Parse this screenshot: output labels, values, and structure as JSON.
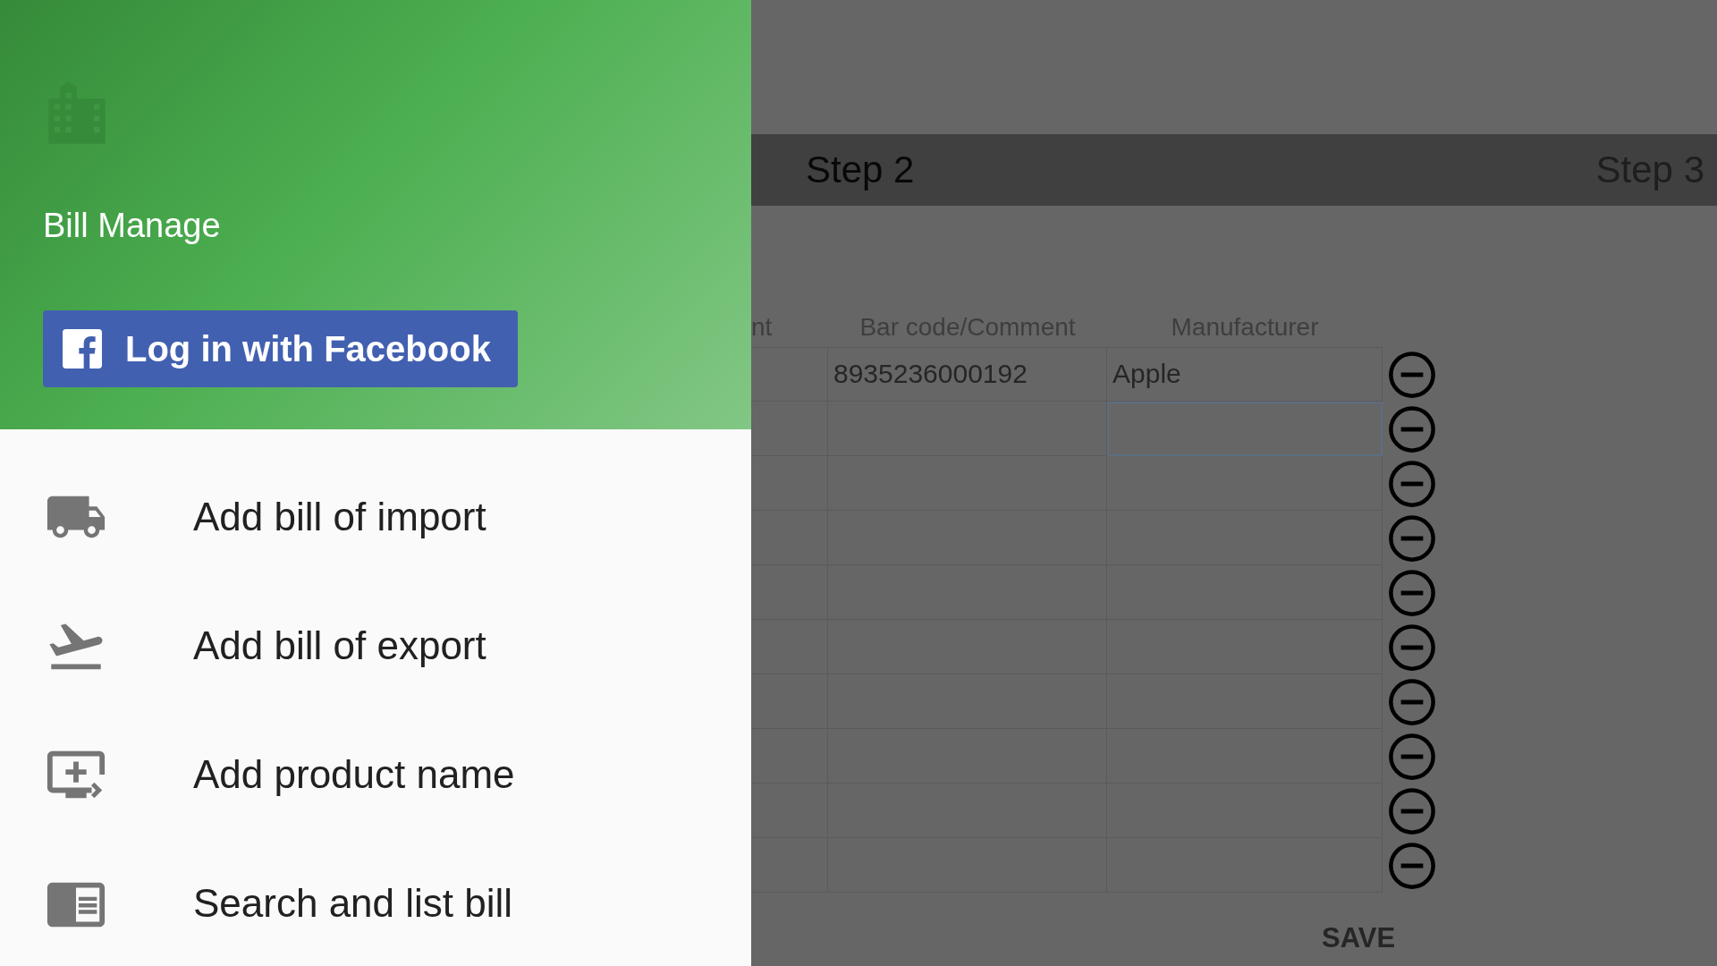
{
  "drawer": {
    "title": "Bill Manage",
    "login_button": "Log in with Facebook",
    "items": [
      {
        "label": "Add bill of import",
        "kind": "truck"
      },
      {
        "label": "Add bill of export",
        "kind": "takeoff"
      },
      {
        "label": "Add product name",
        "kind": "monitor"
      },
      {
        "label": "Search and list bill",
        "kind": "reader"
      }
    ]
  },
  "step_bar": {
    "steps": [
      {
        "label": "Step 2",
        "selected": true
      },
      {
        "label": "Step 3",
        "selected": false
      }
    ]
  },
  "table": {
    "columns": [
      "nt",
      "Bar code/Comment",
      "Manufacturer"
    ],
    "rows": [
      {
        "barcode": "8935236000192",
        "manufacturer": "Apple",
        "focused": false
      },
      {
        "focused": true
      },
      {
        "focused": false
      },
      {
        "focused": false
      },
      {
        "focused": false
      },
      {
        "focused": false
      },
      {
        "focused": false
      },
      {
        "focused": false
      },
      {
        "focused": false
      },
      {
        "focused": false
      }
    ]
  },
  "save_button": "SAVE"
}
